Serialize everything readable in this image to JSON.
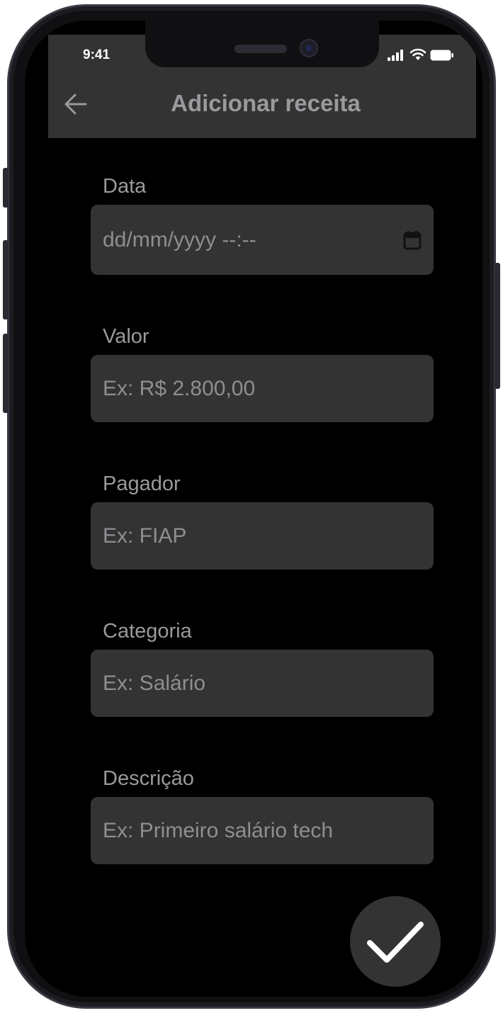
{
  "status_bar": {
    "time": "9:41",
    "icons": [
      "cellular-signal-icon",
      "wifi-icon",
      "battery-icon"
    ]
  },
  "header": {
    "title": "Adicionar receita",
    "back_icon": "arrow-left-icon"
  },
  "form": {
    "data": {
      "label": "Data",
      "placeholder": "dd/mm/yyyy --:--",
      "icon": "calendar-icon"
    },
    "valor": {
      "label": "Valor",
      "placeholder": "Ex: R$ 2.800,00"
    },
    "pagador": {
      "label": "Pagador",
      "placeholder": "Ex: FIAP"
    },
    "categoria": {
      "label": "Categoria",
      "placeholder": "Ex: Salário"
    },
    "descricao": {
      "label": "Descrição",
      "placeholder": "Ex: Primeiro salário tech"
    }
  },
  "confirm_button": {
    "icon": "checkmark-icon"
  },
  "colors": {
    "background": "#000000",
    "surface": "#333333",
    "text_muted": "#9a9a9e",
    "frame": "#101012"
  }
}
